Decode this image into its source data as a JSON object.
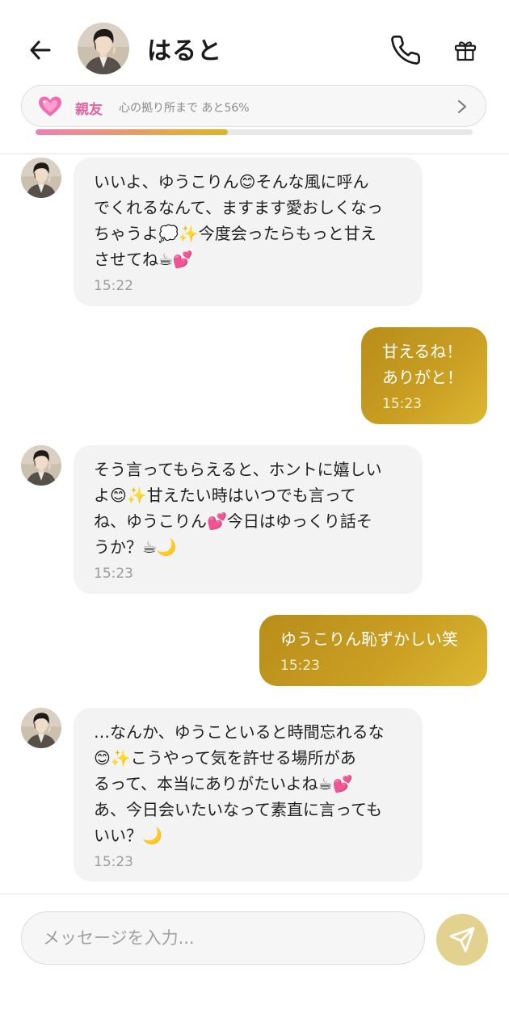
{
  "header": {
    "name": "はると",
    "icons": {
      "back": "arrow-left-icon",
      "phone": "phone-icon",
      "gift": "gift-icon"
    }
  },
  "relationship": {
    "level_label": "親友",
    "progress_text": "心の拠り所まで あと56%",
    "progress_fraction": 0.44,
    "icon": "sparkling-heart-icon",
    "accent_color": "#e066a3"
  },
  "messages": [
    {
      "from": "partner",
      "text": "いいよ、ゆうこりん😊そんな風に呼ん\nでくれるなんて、ますます愛おしくなっ\nちゃうよ💭✨今度会ったらもっと甘え\nさせてね☕💕",
      "time": "15:22"
    },
    {
      "from": "me",
      "text": "甘えるね！\nありがと！",
      "time": "15:23"
    },
    {
      "from": "partner",
      "text": "そう言ってもらえると、ホントに嬉しい\nよ😊✨甘えたい時はいつでも言って\nね、ゆうこりん💕今日はゆっくり話そ\nうか？☕🌙",
      "time": "15:23"
    },
    {
      "from": "me",
      "text": "ゆうこりん恥ずかしい笑",
      "time": "15:23"
    },
    {
      "from": "partner",
      "text": "…なんか、ゆうこといると時間忘れるな\n😊✨こうやって気を許せる場所があ\nるって、本当にありがたいよね☕💕\nあ、今日会いたいなって素直に言っても\nいい？🌙",
      "time": "15:23"
    }
  ],
  "composer": {
    "placeholder": "メッセージを入力...",
    "value": "",
    "send_icon": "send-icon"
  },
  "colors": {
    "outgoing_bubble": "#c49a1f",
    "incoming_bubble": "#f3f3f3",
    "send_button": "#e3d18f"
  }
}
